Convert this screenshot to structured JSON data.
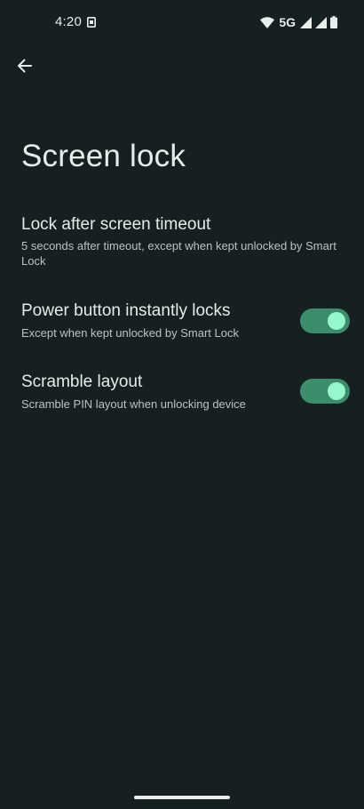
{
  "status_bar": {
    "time": "4:20",
    "network": "5G",
    "icons": [
      "sim-notification-icon",
      "wifi-icon",
      "signal-icon",
      "signal-icon",
      "battery-icon"
    ]
  },
  "header": {
    "back_icon": "arrow-left-icon",
    "title": "Screen lock"
  },
  "settings": [
    {
      "title": "Lock after screen timeout",
      "summary": "5 seconds after timeout, except when kept unlocked by Smart Lock"
    },
    {
      "title": "Power button instantly locks",
      "summary": "Except when kept unlocked by Smart Lock",
      "toggle_on": true
    },
    {
      "title": "Scramble layout",
      "summary": "Scramble PIN layout when unlocking device",
      "toggle_on": true
    }
  ],
  "colors": {
    "background": "#172020",
    "toggle_track": "#3b8d6b",
    "toggle_thumb": "#96f6cc"
  }
}
